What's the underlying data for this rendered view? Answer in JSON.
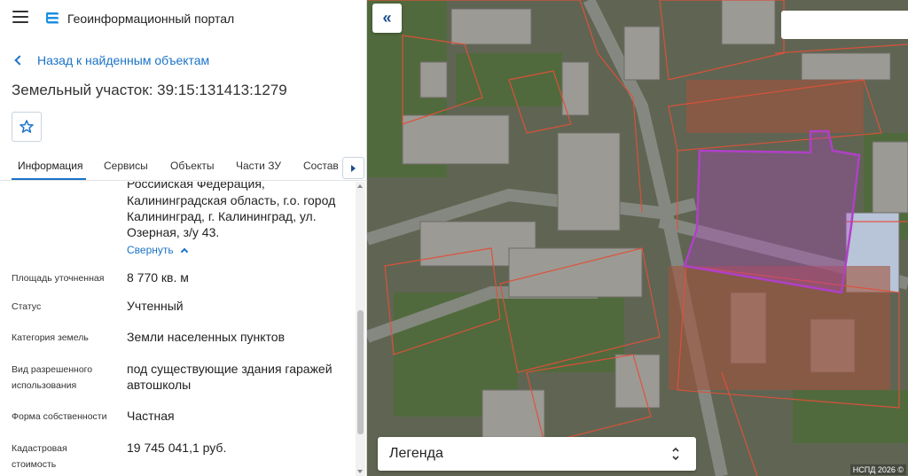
{
  "header": {
    "portal_title": "Геоинформационный портал",
    "menu_icon": "hamburger-icon",
    "logo_icon": "portal-logo-icon"
  },
  "nav": {
    "back_label": "Назад к найденным объектам"
  },
  "parcel": {
    "title": "Земельный участок: 39:15:131413:1279",
    "favorite_icon": "star-icon"
  },
  "tabs": [
    {
      "label": "Информация",
      "active": true
    },
    {
      "label": "Сервисы",
      "active": false
    },
    {
      "label": "Объекты",
      "active": false
    },
    {
      "label": "Части ЗУ",
      "active": false
    },
    {
      "label": "Состав",
      "active": false
    }
  ],
  "address": {
    "lines": [
      "Российская Федерация,",
      "Калининградская область, г.о. город",
      "Калининград, г. Калининград, ул.",
      "Озерная, з/у 43."
    ],
    "collapse_label": "Свернуть"
  },
  "properties": [
    {
      "label_lines": [
        "Площадь уточненная"
      ],
      "value_lines": [
        "8 770 кв. м"
      ]
    },
    {
      "label_lines": [
        "Статус"
      ],
      "value_lines": [
        "Учтенный"
      ]
    },
    {
      "label_lines": [
        "Категория земель"
      ],
      "value_lines": [
        "Земли населенных пунктов"
      ]
    },
    {
      "label_lines": [
        "Вид разрешенного",
        "использования"
      ],
      "value_lines": [
        "под существующие здания гаражей",
        "автошколы"
      ]
    },
    {
      "label_lines": [
        "Форма собственности"
      ],
      "value_lines": [
        "Частная"
      ]
    },
    {
      "label_lines": [
        "Кадастровая",
        "стоимость"
      ],
      "value_lines": [
        "19 745 041,1 руб."
      ]
    }
  ],
  "map": {
    "legend_label": "Легенда",
    "copyright": "НСПД 2026 ©",
    "search_value": "",
    "selected_parcel_color": "#b040c8",
    "parcel_border_color": "#e0503a"
  },
  "colors": {
    "accent": "#1a73c7"
  }
}
